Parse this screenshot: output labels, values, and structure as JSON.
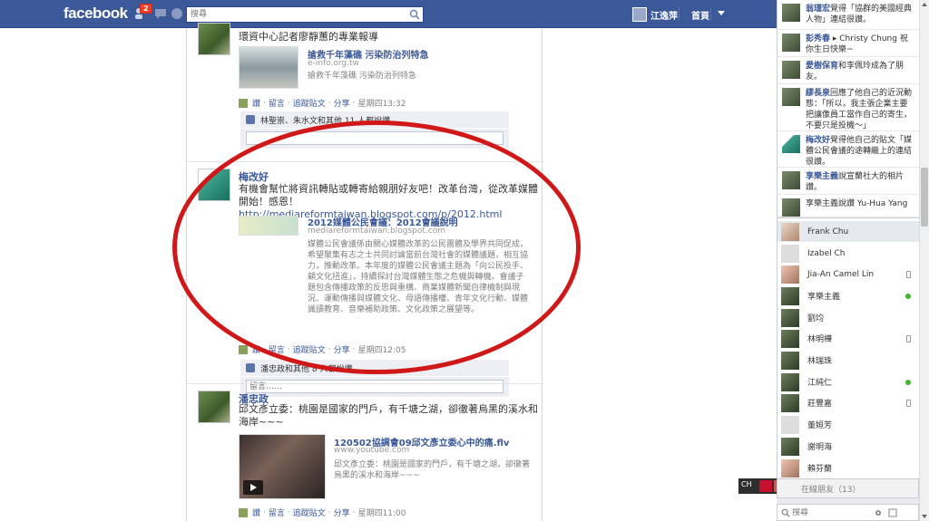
{
  "header": {
    "logo": "facebook",
    "friend_requests_count": "2",
    "search_placeholder": "搜尋",
    "profile_name": "江逸萍",
    "home_label": "首頁"
  },
  "stories": [
    {
      "author": "",
      "message": "環資中心記者廖靜蕙的專業報導",
      "attach_title": "搶救千年藻礁 污染防治列特急",
      "attach_url": "e-info.org.tw",
      "attach_desc": "搶救千年藻礁 污染防治列特急",
      "actions": [
        "讚",
        "留言",
        "追蹤貼文",
        "分享",
        "星期四13:32"
      ],
      "likes_text": "林聖崇、朱水文和其他 11 人都說讚。",
      "comment_placeholder": ""
    },
    {
      "author": "梅改好",
      "message": "有機會幫忙將資訊轉貼或轉寄給親朋好友吧！改革台灣，從改革媒體開始！感恩！",
      "message_link": "http://mediareformtaiwan.blogspot.com/p/2012.html",
      "attach_title": "2012媒體公民會議：2012會議說明",
      "attach_url": "mediareformtaiwan.blogspot.com",
      "attach_desc": "媒體公民會議係由關心媒體改革的公民團體及學界共同促成，希望聚集有志之士共同討論當前台灣社會的媒體議題，相互協力，推動改革。本年度的媒體公民會議主題為「向公民投手、顧文化扭進」，持續探討台灣媒體生態之危機與轉機。會議子題包含傳播政策的反思與重構、商業媒體新聞自律機制與現況、運動傳播與媒體文化、母語傳播權、青年文化行動、媒體識讀教育、音樂補助政策、文化政策之展望等。",
      "actions": [
        "讚",
        "留言",
        "追蹤貼文",
        "分享",
        "星期四12:05"
      ],
      "likes_text": "潘忠政和其他 8 人都說讚。",
      "comment_placeholder": "留言……"
    },
    {
      "author": "潘忠政",
      "message": "邱文彥立委：桃園是國家的門戶，有千塘之湖，卻徹著烏黑的溪水和海岸~~~",
      "attach_title": "120502協調會09邱文彥立委心中的痛.flv",
      "attach_url": "www.youtube.com",
      "attach_desc": "邱文彥立委：桃園是國家的門戶，有千塘之湖，卻徹著烏黑的溪水和海岸~~~",
      "actions": [
        "讚",
        "留言",
        "追蹤貼文",
        "分享",
        "星期四11:00"
      ]
    }
  ],
  "ticker": [
    {
      "name": "翁瑾宏",
      "text": "覺得「協群的美國經典人物」連結很讚。"
    },
    {
      "name": "彭秀春",
      "text": "▸ Christy Chung 祝你生日快樂~"
    },
    {
      "name": "愛樹保育",
      "text": "和李佩玲成為了朋友。"
    },
    {
      "name": "繆長泉",
      "text": "回應了他自己的近況動態：「所以，我主張企業主要把讓像員工當作自己的寄生，不要只是投機～」"
    },
    {
      "name": "梅改好",
      "text": "覺得他自己的貼文「媒體公民會議的途轉繼上的連結很讚。"
    },
    {
      "name": "享樂主義",
      "text": "說宣蘭社大的相片讚。"
    },
    {
      "name": "",
      "text": "享樂主義說讚 Yu-Hua Yang"
    }
  ],
  "chat_friends": [
    {
      "name": "Frank Chu",
      "status": "none",
      "highlight": true
    },
    {
      "name": "Izabel Ch",
      "status": "none",
      "highlight": false
    },
    {
      "name": "Jia-An Camel Lin",
      "status": "mobile",
      "highlight": false
    },
    {
      "name": "享樂主義",
      "status": "online",
      "highlight": false
    },
    {
      "name": "劉均",
      "status": "none",
      "highlight": false
    },
    {
      "name": "林明樺",
      "status": "mobile",
      "highlight": false
    },
    {
      "name": "林瑞珠",
      "status": "none",
      "highlight": false
    },
    {
      "name": "江純仁",
      "status": "online",
      "highlight": false
    },
    {
      "name": "莊豐嘉",
      "status": "mobile",
      "highlight": false
    },
    {
      "name": "董姮芳",
      "status": "none",
      "highlight": false
    },
    {
      "name": "謝明海",
      "status": "none",
      "highlight": false
    },
    {
      "name": "賴芬蘭",
      "status": "none",
      "highlight": false
    }
  ],
  "chat": {
    "online_label": "在線朋友（13）",
    "search_placeholder": "搜尋",
    "ime_label": "CH"
  }
}
